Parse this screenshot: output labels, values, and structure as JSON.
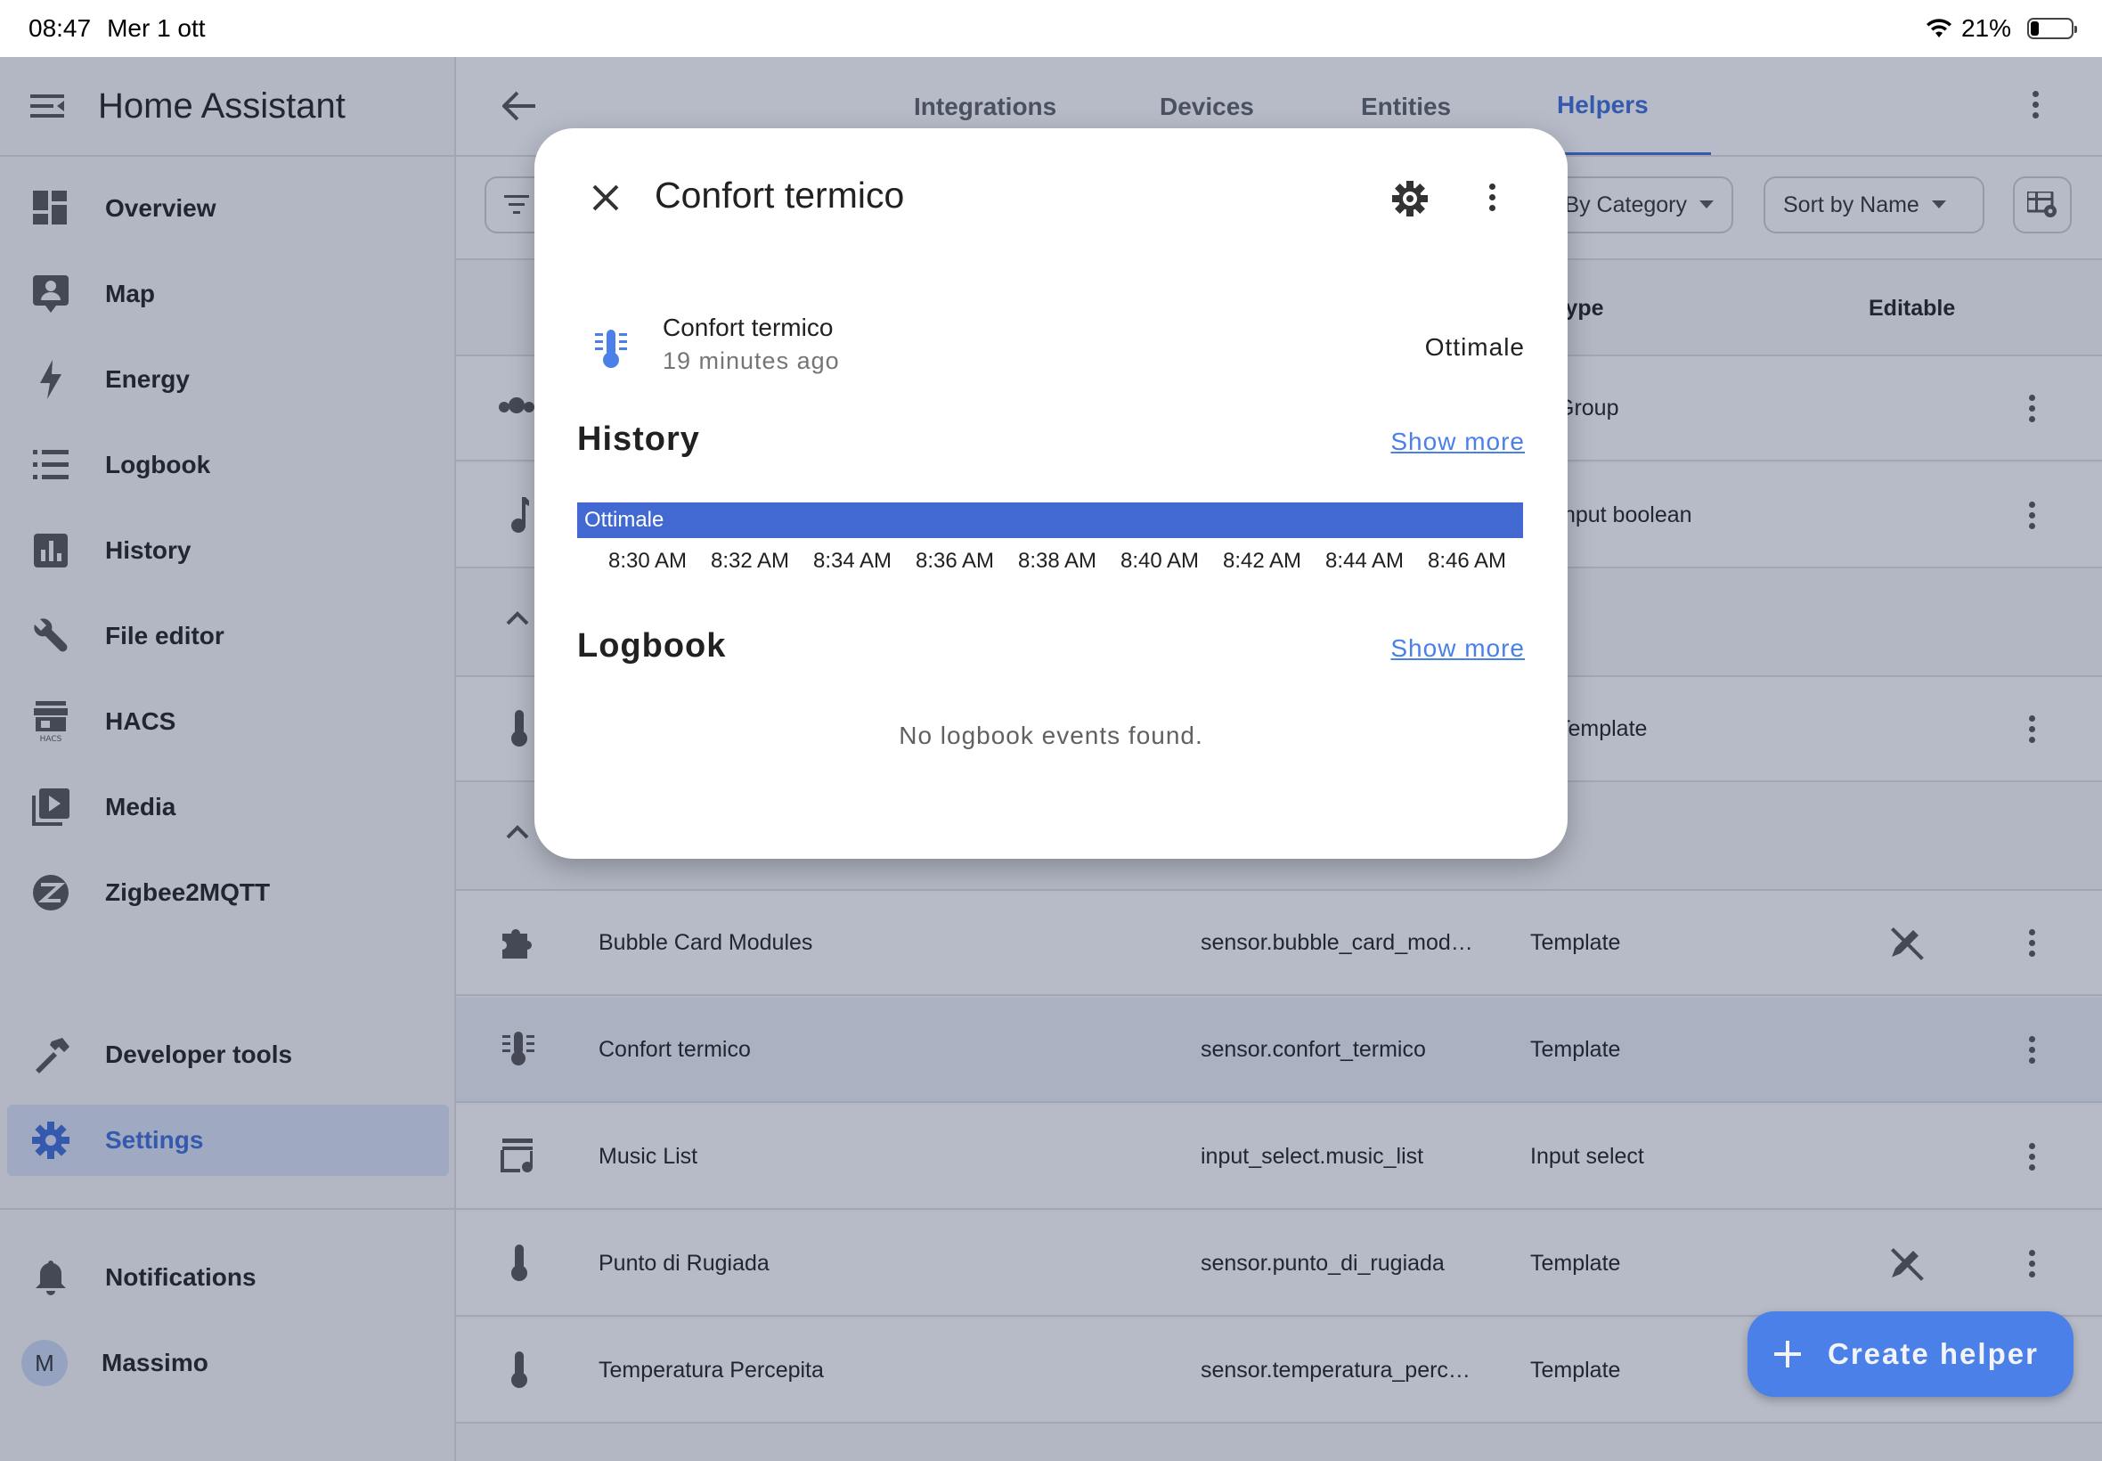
{
  "status": {
    "time": "08:47",
    "date": "Mer 1 ott",
    "battery": "21%"
  },
  "sidebar": {
    "title": "Home Assistant",
    "items": [
      {
        "label": "Overview",
        "icon": "dashboard-icon"
      },
      {
        "label": "Map",
        "icon": "map-icon"
      },
      {
        "label": "Energy",
        "icon": "lightning-icon"
      },
      {
        "label": "Logbook",
        "icon": "list-icon"
      },
      {
        "label": "History",
        "icon": "chart-bar-icon"
      },
      {
        "label": "File editor",
        "icon": "wrench-icon"
      },
      {
        "label": "HACS",
        "icon": "hacs-store-icon"
      },
      {
        "label": "Media",
        "icon": "media-icon"
      },
      {
        "label": "Zigbee2MQTT",
        "icon": "zigbee-icon"
      }
    ],
    "developer_tools": "Developer tools",
    "settings": "Settings",
    "notifications": "Notifications",
    "user": {
      "initial": "M",
      "name": "Massimo"
    }
  },
  "tabs": [
    "Integrations",
    "Devices",
    "Entities",
    "Helpers"
  ],
  "active_tab": "Helpers",
  "filters": {
    "group_by": "By Category",
    "sort": "Sort by Name"
  },
  "table": {
    "header_type": "Type",
    "header_editable": "Editable",
    "partial_rows": [
      "Group",
      "Input boolean",
      "Template"
    ],
    "rows": [
      {
        "name": "Bubble Card Modules",
        "entity": "sensor.bubble_card_mod…",
        "type": "Template",
        "not_editable": true
      },
      {
        "name": "Confort termico",
        "entity": "sensor.confort_termico",
        "type": "Template",
        "not_editable": false
      },
      {
        "name": "Music List",
        "entity": "input_select.music_list",
        "type": "Input select",
        "not_editable": false
      },
      {
        "name": "Punto di Rugiada",
        "entity": "sensor.punto_di_rugiada",
        "type": "Template",
        "not_editable": true
      },
      {
        "name": "Temperatura Percepita",
        "entity": "sensor.temperatura_perc…",
        "type": "Template",
        "not_editable": false
      }
    ]
  },
  "fab": {
    "label": "Create helper"
  },
  "dialog": {
    "title": "Confort termico",
    "entity_name": "Confort termico",
    "last_changed": "19 minutes ago",
    "state": "Ottimale",
    "history_title": "History",
    "show_more": "Show more",
    "timeline_state": "Ottimale",
    "timeline_ticks": [
      "8:30 AM",
      "8:32 AM",
      "8:34 AM",
      "8:36 AM",
      "8:38 AM",
      "8:40 AM",
      "8:42 AM",
      "8:44 AM",
      "8:46 AM"
    ],
    "logbook_title": "Logbook",
    "logbook_empty": "No logbook events found."
  },
  "colors": {
    "accent": "#3f6fd8",
    "timeline_bar": "#4169d1",
    "fab": "#4a80e8"
  }
}
